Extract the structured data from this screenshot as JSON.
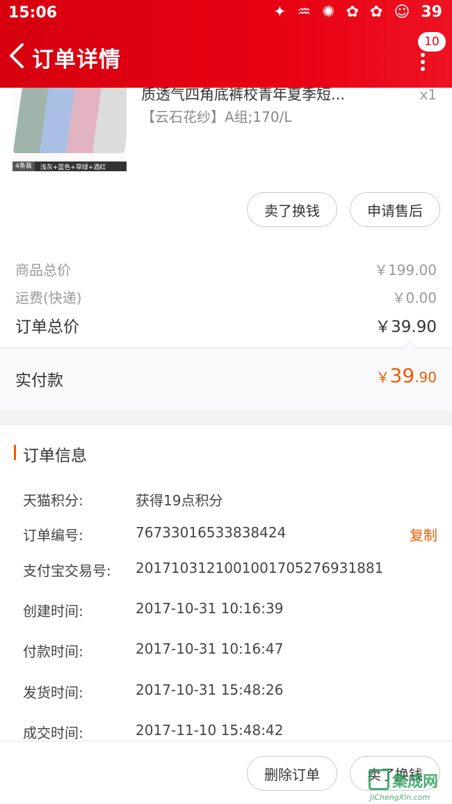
{
  "status_bar": {
    "time": "15:06",
    "battery": "39"
  },
  "header": {
    "title": "订单详情",
    "badge": "10"
  },
  "product": {
    "name": "质透气四角底裤校青年夏季短...",
    "sku": "【云石花纱】A组;170/L",
    "qty": "x1",
    "thumb_caption_pack": "4条装",
    "thumb_caption_colors": "浅灰+蓝色+草绿+酒红",
    "actions": {
      "sell": "卖了换钱",
      "after_sale": "申请售后"
    }
  },
  "prices": {
    "goods_label": "商品总价",
    "goods_value": "￥199.00",
    "shipping_label": "运费(快递)",
    "shipping_value": "￥0.00",
    "total_label": "订单总价",
    "total_value": "￥39.90",
    "paid_label": "实付款",
    "paid_currency": "￥",
    "paid_int": "39",
    "paid_dec": ".90"
  },
  "order_info": {
    "title": "订单信息",
    "rows": [
      {
        "key": "天猫积分:",
        "value": "获得19点积分"
      },
      {
        "key": "订单编号:",
        "value": "76733016533838424"
      },
      {
        "key": "支付宝交易号:",
        "value": "2017103121001001705276931881"
      },
      {
        "key": "创建时间:",
        "value": "2017-10-31 10:16:39"
      },
      {
        "key": "付款时间:",
        "value": "2017-10-31 10:16:47"
      },
      {
        "key": "发货时间:",
        "value": "2017-10-31 15:48:26"
      },
      {
        "key": "成交时间:",
        "value": "2017-11-10 15:48:42"
      }
    ],
    "copy_label": "复制"
  },
  "bottom_bar": {
    "delete_label": "删除订单",
    "sell_label": "卖了换钱"
  },
  "watermark": {
    "main": "集成网",
    "sub": "JiChengXin.com"
  },
  "colors": {
    "brand_red": "#e60012",
    "accent_orange": "#f05a00"
  }
}
